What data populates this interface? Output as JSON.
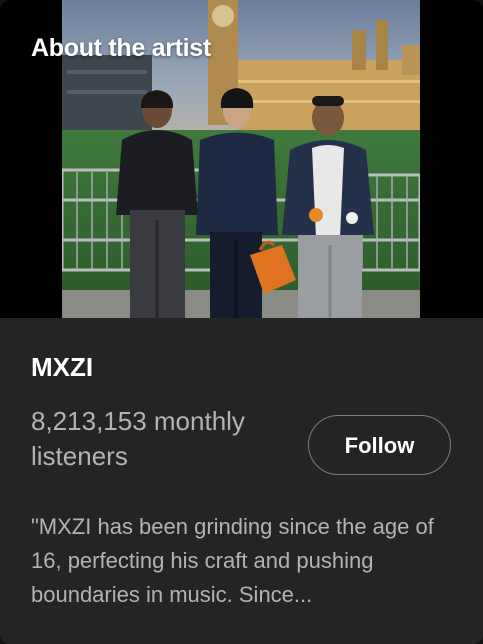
{
  "section": {
    "heading": "About the artist"
  },
  "artist": {
    "name": "MXZI",
    "monthly_listeners": "8,213,153 monthly listeners",
    "follow_label": "Follow",
    "bio": "\"MXZI has been grinding since the age of 16, perfecting his craft and pushing boundaries in music. Since..."
  },
  "colors": {
    "card_background": "#242424",
    "muted_text": "#b3b3b3",
    "primary_text": "#ffffff",
    "button_border": "#7c7c7c"
  }
}
